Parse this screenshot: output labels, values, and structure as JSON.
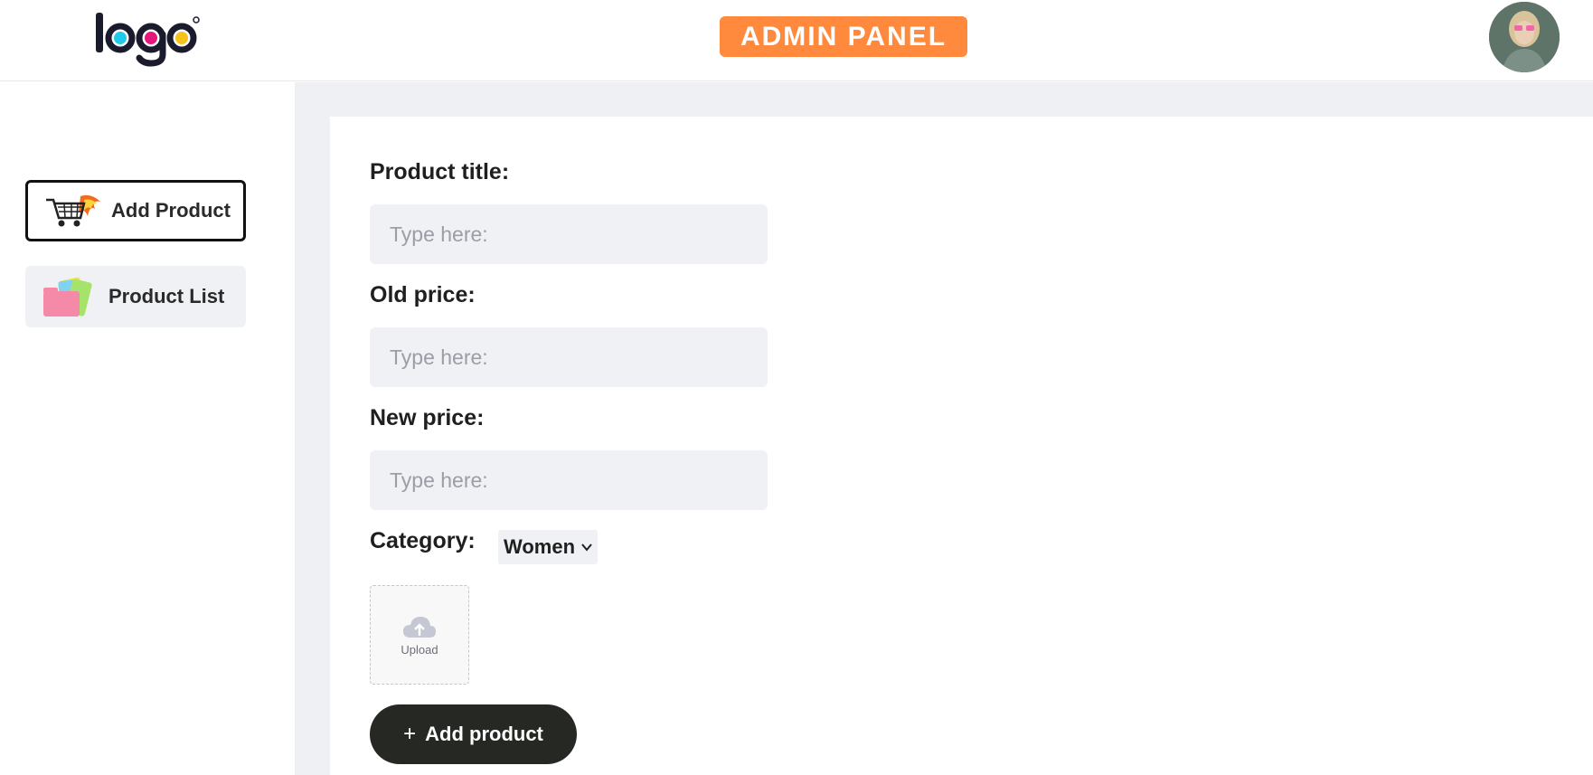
{
  "header": {
    "logo_text": "logo",
    "badge": "ADMIN PANEL",
    "badge_color": "#ff8a3d"
  },
  "sidebar": {
    "items": [
      {
        "label": "Add Product",
        "icon": "cart-fire-icon",
        "active": true
      },
      {
        "label": "Product List",
        "icon": "folders-icon",
        "active": false
      }
    ]
  },
  "form": {
    "title_label": "Product title:",
    "title_placeholder": "Type here:",
    "old_price_label": "Old price:",
    "old_price_placeholder": "Type here:",
    "new_price_label": "New price:",
    "new_price_placeholder": "Type here:",
    "category_label": "Category:",
    "category_value": "Women",
    "upload_label": "Upload",
    "submit_label": "Add product",
    "submit_icon": "plus-icon"
  }
}
